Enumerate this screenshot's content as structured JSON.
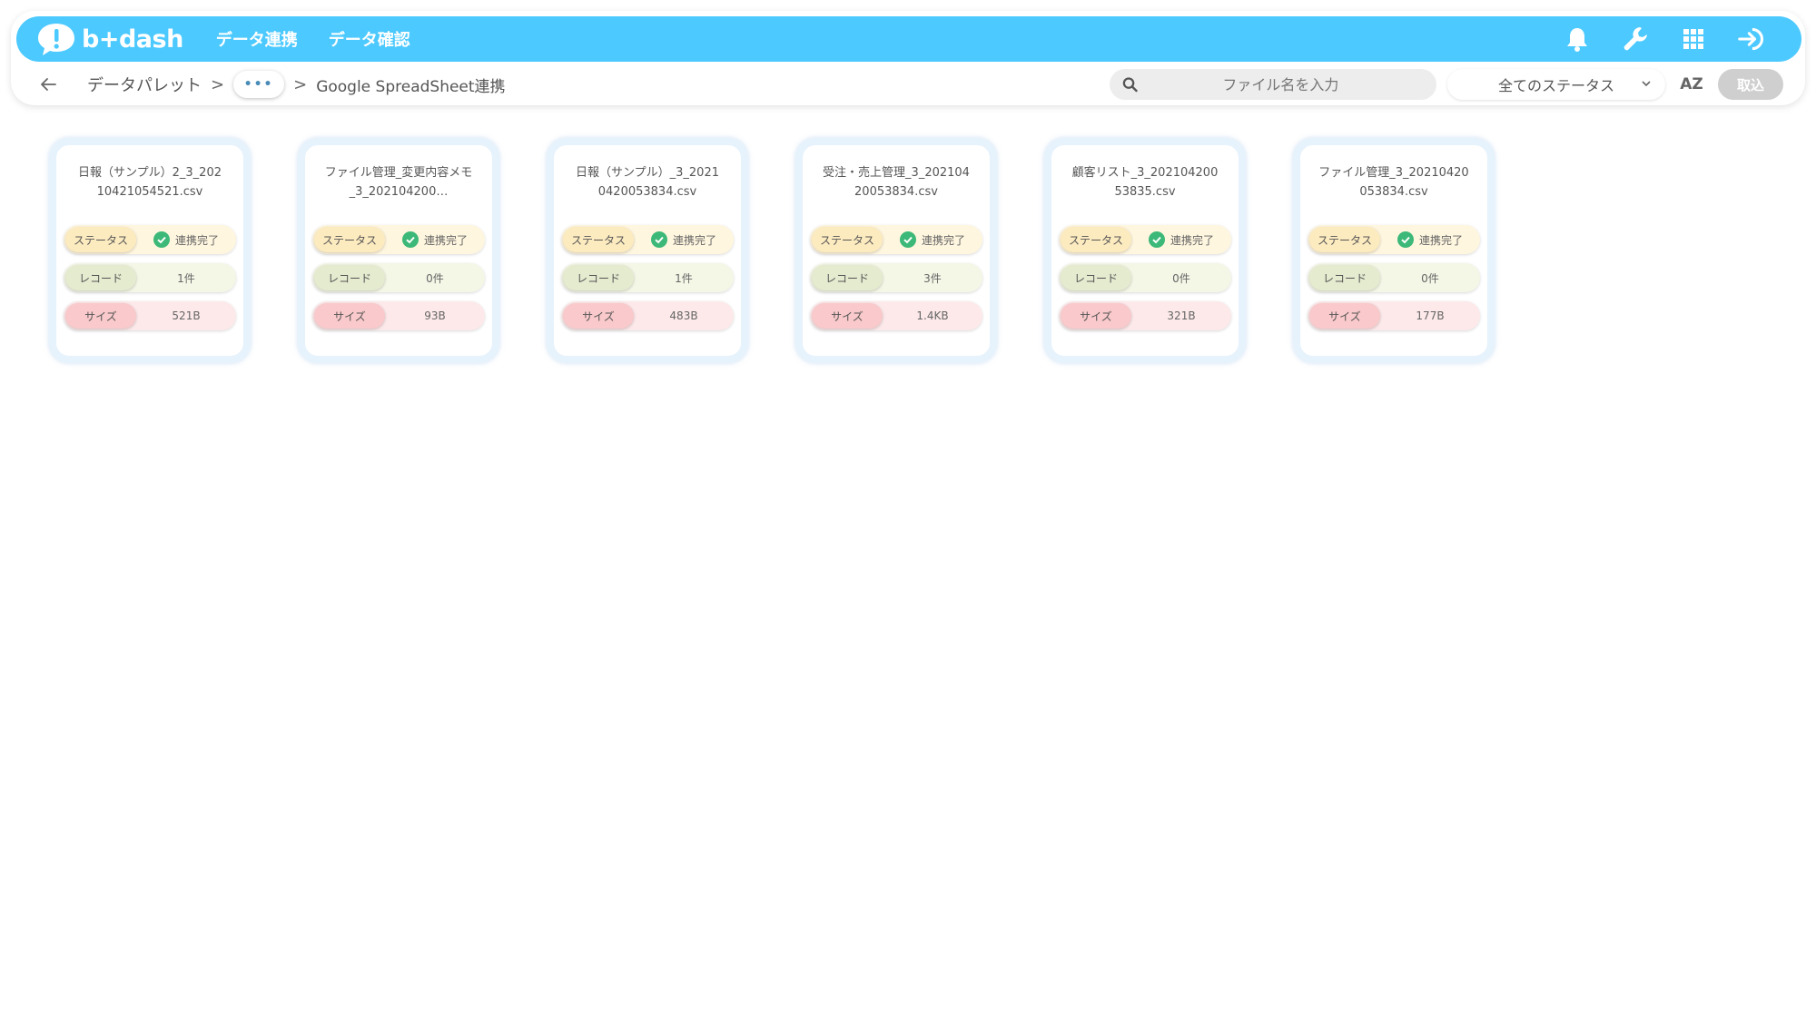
{
  "header": {
    "logo_text": "b+dash",
    "nav": [
      "データ連携",
      "データ確認"
    ]
  },
  "breadcrumb": {
    "root": "データパレット",
    "sep": ">",
    "ellipsis": "•••",
    "current": "Google SpreadSheet連携"
  },
  "toolbar": {
    "search_placeholder": "ファイル名を入力",
    "status_filter": "全てのステータス",
    "sort_label": "AZ",
    "import_label": "取込"
  },
  "labels": {
    "status": "ステータス",
    "record": "レコード",
    "size": "サイズ"
  },
  "colors": {
    "header": "#4cc9ff",
    "success": "#3cb878"
  },
  "files": [
    {
      "name": "日報（サンプル）2_3_20210421054521.csv",
      "status": "連携完了",
      "records": "1件",
      "size": "521B"
    },
    {
      "name": "ファイル管理_変更内容メモ_3_202104200…",
      "status": "連携完了",
      "records": "0件",
      "size": "93B"
    },
    {
      "name": "日報（サンプル）_3_20210420053834.csv",
      "status": "連携完了",
      "records": "1件",
      "size": "483B"
    },
    {
      "name": "受注・売上管理_3_20210420053834.csv",
      "status": "連携完了",
      "records": "3件",
      "size": "1.4KB"
    },
    {
      "name": "顧客リスト_3_20210420053835.csv",
      "status": "連携完了",
      "records": "0件",
      "size": "321B"
    },
    {
      "name": "ファイル管理_3_20210420053834.csv",
      "status": "連携完了",
      "records": "0件",
      "size": "177B"
    }
  ]
}
